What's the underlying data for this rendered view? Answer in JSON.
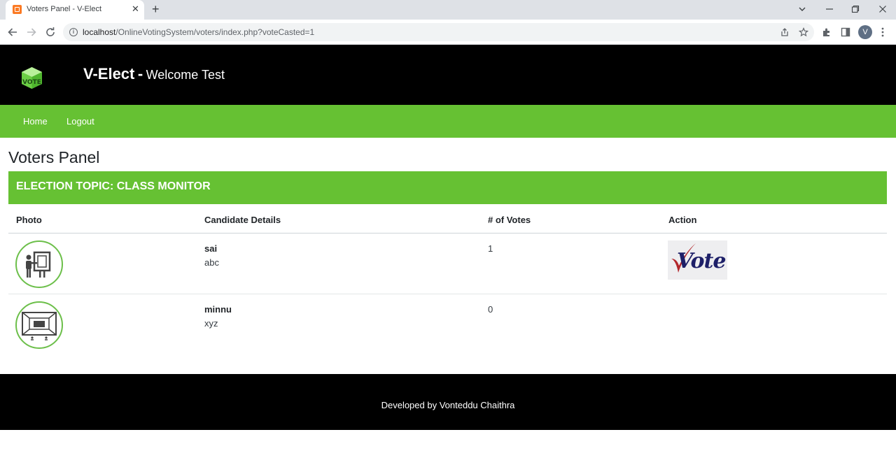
{
  "browser": {
    "tab_title": "Voters Panel - V-Elect",
    "tab_close": "✕",
    "new_tab": "+",
    "url_host": "localhost",
    "url_path": "/OnlineVotingSystem/voters/index.php?voteCasted=1",
    "profile_initial": "V",
    "icons": [
      "favicon-icon",
      "back-icon",
      "forward-icon",
      "reload-icon",
      "site-info-icon",
      "share-icon",
      "bookmark-star-icon",
      "extensions-icon",
      "side-panel-icon",
      "menu-icon",
      "tab-search-icon",
      "minimize-icon",
      "maximize-icon",
      "window-close-icon"
    ]
  },
  "header": {
    "brand": "V-Elect",
    "separator": "-",
    "welcome": "Welcome Test",
    "logo_text": "VOTE"
  },
  "nav": {
    "home": "Home",
    "logout": "Logout"
  },
  "page": {
    "title": "Voters Panel",
    "topic": "ELECTION TOPIC: CLASS MONITOR"
  },
  "table": {
    "headers": {
      "photo": "Photo",
      "details": "Candidate Details",
      "votes": "# of Votes",
      "action": "Action"
    },
    "rows": [
      {
        "name": "sai",
        "detail": "abc",
        "votes": "1",
        "photo_icon": "presenter-icon",
        "has_vote_button": true,
        "vote_label": "Vote"
      },
      {
        "name": "minnu",
        "detail": "xyz",
        "votes": "0",
        "photo_icon": "screen-stage-icon",
        "has_vote_button": false
      }
    ]
  },
  "footer": {
    "text": "Developed by Vonteddu Chaithra"
  },
  "colors": {
    "header_bg": "#000000",
    "accent_green": "#66c133",
    "vote_check": "#b3282d",
    "vote_text": "#1d1f68"
  }
}
